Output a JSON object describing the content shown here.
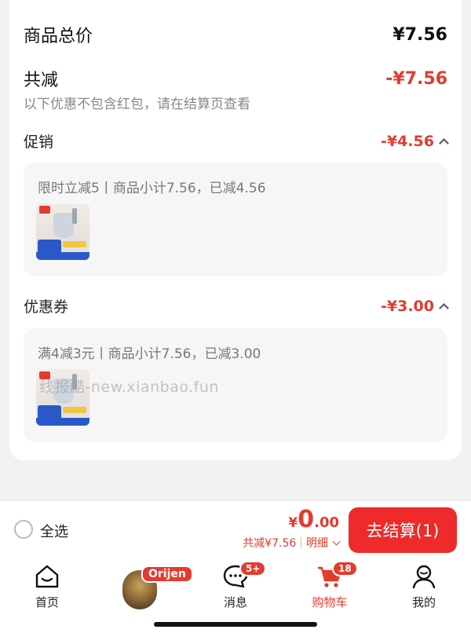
{
  "summary": {
    "total_label": "商品总价",
    "total_value": "¥7.56",
    "discount_label": "共减",
    "discount_value": "-¥7.56",
    "note": "以下优惠不包含红包，请在结算页查看"
  },
  "promotion": {
    "label": "促销",
    "value": "-¥4.56",
    "detail": "限时立减5丨商品小计7.56，已减4.56"
  },
  "coupon": {
    "label": "优惠券",
    "value": "-¥3.00",
    "detail": "满4减3元丨商品小计7.56，已减3.00"
  },
  "watermark": "线报酷-new.xianbao.fun",
  "bottom_bar": {
    "select_all": "全选",
    "price_symbol": "¥",
    "price_int": "0",
    "price_dec": ".00",
    "total_discount": "共减¥7.56",
    "detail_label": "明细",
    "checkout_label": "去结算(1)"
  },
  "tabbar": {
    "home": "首页",
    "product_badge": "Orijen",
    "messages": "消息",
    "messages_badge": "5+",
    "cart": "购物车",
    "cart_badge": "18",
    "mine": "我的"
  },
  "colors": {
    "accent": "#e33b2e",
    "checkout": "#ee2a2a"
  }
}
